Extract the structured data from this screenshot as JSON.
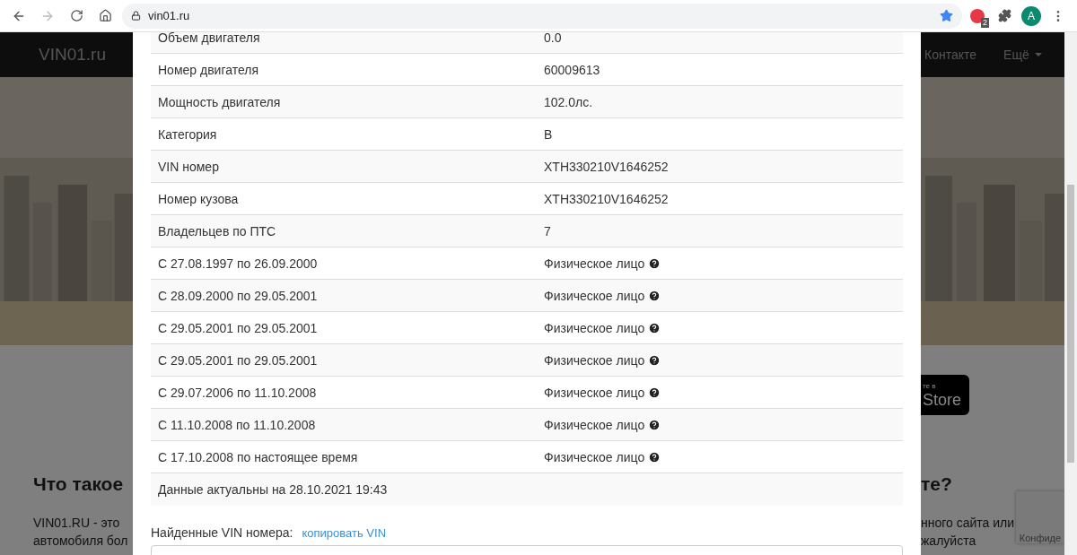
{
  "browser": {
    "url": "vin01.ru",
    "extension_badge": "2",
    "profile_initial": "A"
  },
  "background_page": {
    "logo": "VIN01.ru",
    "nav_items": [
      {
        "label": "Контакте",
        "kind": "link"
      },
      {
        "label": "Ещё",
        "kind": "dropdown"
      }
    ],
    "left_heading": "Что такое",
    "left_lines": [
      "VIN01.RU - это",
      "автомобиля бол"
    ],
    "store_badge": {
      "small": "те в",
      "large": "Store"
    },
    "right_heading": "те?",
    "right_lines": [
      "нного сайта или",
      "жалуйста"
    ],
    "recaptcha_label": "Конфиде"
  },
  "modal": {
    "rows": [
      {
        "label": "Объем двигателя",
        "value": "0.0",
        "kind": "plain"
      },
      {
        "label": "Номер двигателя",
        "value": "60009613",
        "kind": "plain"
      },
      {
        "label": "Мощность двигателя",
        "value": "102.0лс.",
        "kind": "plain"
      },
      {
        "label": "Категория",
        "value": "B",
        "kind": "plain"
      },
      {
        "label": "VIN номер",
        "value": "XTH330210V1646252",
        "kind": "plain"
      },
      {
        "label": "Номер кузова",
        "value": "XTH330210V1646252",
        "kind": "plain"
      },
      {
        "label": "Владельцев по ПТС",
        "value": "7",
        "kind": "plain"
      },
      {
        "label": "С 27.08.1997 по 26.09.2000",
        "value": "Физическое лицо",
        "kind": "owner"
      },
      {
        "label": "С 28.09.2000 по 29.05.2001",
        "value": "Физическое лицо",
        "kind": "owner"
      },
      {
        "label": "С 29.05.2001 по 29.05.2001",
        "value": "Физическое лицо",
        "kind": "owner"
      },
      {
        "label": "С 29.05.2001 по 29.05.2001",
        "value": "Физическое лицо",
        "kind": "owner"
      },
      {
        "label": "С 29.07.2006 по 11.10.2008",
        "value": "Физическое лицо",
        "kind": "owner"
      },
      {
        "label": "С 11.10.2008 по 11.10.2008",
        "value": "Физическое лицо",
        "kind": "owner"
      },
      {
        "label": "С 17.10.2008 по настоящее время",
        "value": "Физическое лицо",
        "kind": "owner"
      }
    ],
    "updated_note": "Данные актуальны на 28.10.2021 19:43",
    "found_label": "Найденные VIN номера:",
    "copy_link": "копировать VIN"
  }
}
